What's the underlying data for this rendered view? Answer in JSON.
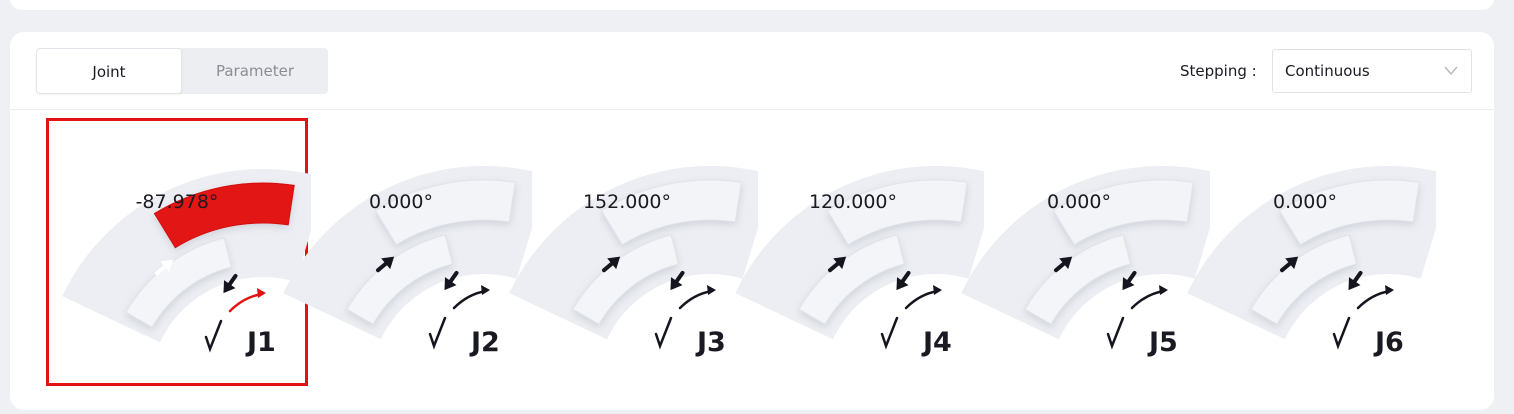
{
  "tabs": [
    {
      "label": "Joint",
      "active": true
    },
    {
      "label": "Parameter",
      "active": false
    }
  ],
  "stepping": {
    "label": "Stepping :",
    "value": "Continuous"
  },
  "colors": {
    "accent": "#e31313",
    "selected_border": "#e31313",
    "arrow": "#15151f"
  },
  "joints": [
    {
      "label": "J1",
      "value": "-87.978°",
      "selected": true
    },
    {
      "label": "J2",
      "value": "0.000°",
      "selected": false
    },
    {
      "label": "J3",
      "value": "152.000°",
      "selected": false
    },
    {
      "label": "J4",
      "value": "120.000°",
      "selected": false
    },
    {
      "label": "J5",
      "value": "0.000°",
      "selected": false
    },
    {
      "label": "J6",
      "value": "0.000°",
      "selected": false
    }
  ]
}
